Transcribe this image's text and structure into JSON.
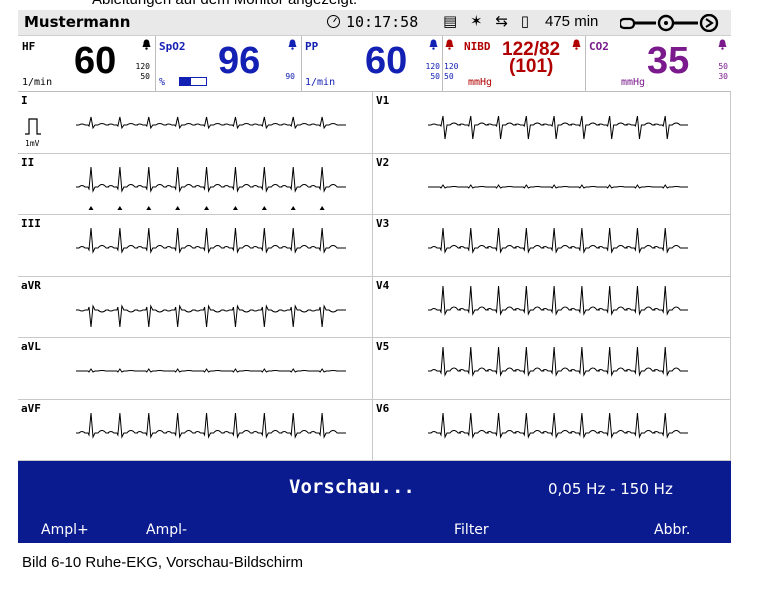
{
  "caption_top": "Ableitungen auf dem Monitor angezeigt.",
  "status": {
    "patient_name": "Mustermann",
    "time": "10:17:58",
    "battery_time": "475 min"
  },
  "params": {
    "hf": {
      "label": "HF",
      "value": "60",
      "unit": "1/min",
      "upper": "120",
      "lower": "50"
    },
    "spo2": {
      "label": "SpO2",
      "value": "96",
      "unit": "%",
      "upper": "",
      "lower": "90"
    },
    "pp": {
      "label": "PP",
      "value": "60",
      "unit": "1/min",
      "upper": "120",
      "lower": "50"
    },
    "nibd": {
      "label": "NIBD",
      "value": "122/82",
      "mean": "(101)",
      "unit": "mmHg"
    },
    "co2": {
      "label": "CO2",
      "value": "35",
      "unit": "mmHg",
      "upper": "50",
      "lower": "30"
    }
  },
  "calibration_label": "1mV",
  "leads_left": [
    "I",
    "II",
    "III",
    "aVR",
    "aVL",
    "aVF"
  ],
  "leads_right": [
    "V1",
    "V2",
    "V3",
    "V4",
    "V5",
    "V6"
  ],
  "screen": {
    "title": "Vorschau...",
    "filter_range": "0,05 Hz - 150 Hz"
  },
  "softkeys": {
    "ampl_plus": "Ampl+",
    "ampl_minus": "Ampl-",
    "filter": "Filter",
    "abort": "Abbr."
  },
  "figure_caption": "Bild 6-10   Ruhe-EKG, Vorschau-Bildschirm",
  "colors": {
    "hf": "#000000",
    "spo2": "#1320b4",
    "pp": "#1320b4",
    "nibd": "#b00000",
    "co2": "#7a1a8c",
    "bar": "#0a1a8f"
  }
}
